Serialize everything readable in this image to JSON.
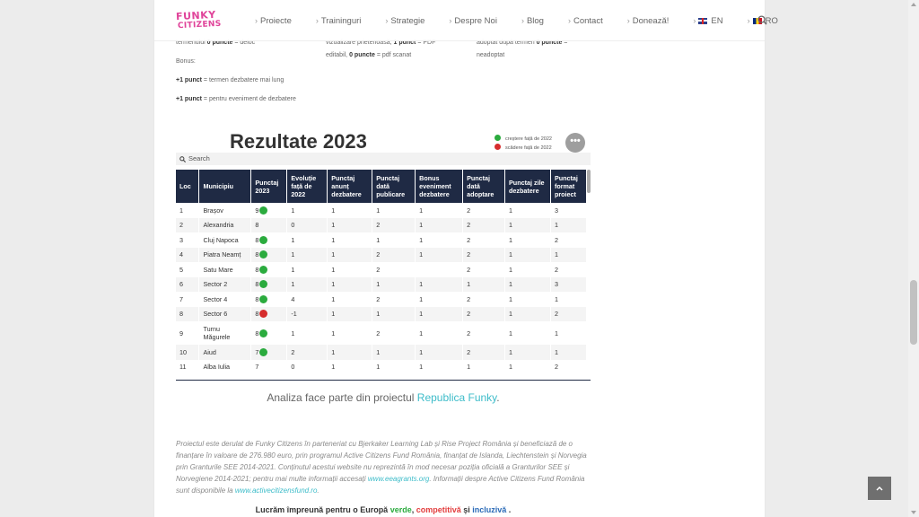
{
  "header": {
    "logo_line1": "FUNKY",
    "logo_line2": "CITIZENS",
    "nav": [
      "Proiecte",
      "Traininguri",
      "Strategie",
      "Despre Noi",
      "Blog",
      "Contact",
      "Donează!"
    ],
    "lang_en": "EN",
    "lang_ro": "RO"
  },
  "prev": {
    "col1_line1_pre": "termenului ",
    "col1_line1_bold": "0 puncte",
    "col1_line1_post": " = deloc",
    "bonus_label": "Bonus:",
    "bonus1_bold": "+1 punct",
    "bonus1_text": " = termen dezbatere mai lung",
    "bonus2_bold": "+1 punct",
    "bonus2_text": " = pentru eveniment de dezbatere",
    "col2_line1_pre": "vizualizare prietenoasă, ",
    "col2_line1_bold": "1 punct",
    "col2_line1_post": " = PDF",
    "col2_line2_pre": "editabil, ",
    "col2_line2_bold": "0 puncte",
    "col2_line2_post": " = pdf scanat",
    "col3_line1_pre": "adoptat după termen ",
    "col3_line1_bold": "0 puncte",
    "col3_line1_post": " =",
    "col3_line2": "neadoptat"
  },
  "widget": {
    "title": "Rezultate 2023",
    "legend_up": "creștere față de 2022",
    "legend_down": "scădere față de 2022",
    "more": "•••",
    "search_placeholder": "Search",
    "colors": {
      "up": "#2bab3e",
      "down": "#d62d2d",
      "header_bg": "#1f2a44"
    },
    "columns": [
      "Loc",
      "Municipiu",
      "Punctaj 2023",
      "Evoluție față de 2022",
      "Punctaj anunț dezbatere",
      "Punctaj dată publicare",
      "Bonus eveniment dezbatere",
      "Punctaj dată adoptare",
      "Punctaj zile dezbatere",
      "Punctaj format proiect"
    ],
    "rows": [
      {
        "loc": "1",
        "mun": "Brașov",
        "score": "9",
        "trend": "up",
        "evo": "1",
        "c4": "1",
        "c5": "1",
        "c6": "1",
        "c7": "2",
        "c8": "1",
        "c9": "3"
      },
      {
        "loc": "2",
        "mun": "Alexandria",
        "score": "8",
        "trend": "",
        "evo": "0",
        "c4": "1",
        "c5": "2",
        "c6": "1",
        "c7": "2",
        "c8": "1",
        "c9": "1"
      },
      {
        "loc": "3",
        "mun": "Cluj Napoca",
        "score": "8",
        "trend": "up",
        "evo": "1",
        "c4": "1",
        "c5": "1",
        "c6": "1",
        "c7": "2",
        "c8": "1",
        "c9": "2"
      },
      {
        "loc": "4",
        "mun": "Piatra Neamț",
        "score": "8",
        "trend": "up",
        "evo": "1",
        "c4": "1",
        "c5": "2",
        "c6": "1",
        "c7": "2",
        "c8": "1",
        "c9": "1"
      },
      {
        "loc": "5",
        "mun": "Satu Mare",
        "score": "8",
        "trend": "up",
        "evo": "1",
        "c4": "1",
        "c5": "2",
        "c6": "",
        "c7": "2",
        "c8": "1",
        "c9": "2"
      },
      {
        "loc": "6",
        "mun": "Sector 2",
        "score": "8",
        "trend": "up",
        "evo": "1",
        "c4": "1",
        "c5": "1",
        "c6": "1",
        "c7": "1",
        "c8": "1",
        "c9": "3"
      },
      {
        "loc": "7",
        "mun": "Sector 4",
        "score": "8",
        "trend": "up",
        "evo": "4",
        "c4": "1",
        "c5": "2",
        "c6": "1",
        "c7": "2",
        "c8": "1",
        "c9": "1"
      },
      {
        "loc": "8",
        "mun": "Sector 6",
        "score": "8",
        "trend": "down",
        "evo": "-1",
        "c4": "1",
        "c5": "1",
        "c6": "1",
        "c7": "2",
        "c8": "1",
        "c9": "2"
      },
      {
        "loc": "9",
        "mun": "Turnu Măgurele",
        "score": "8",
        "trend": "up",
        "evo": "1",
        "c4": "1",
        "c5": "2",
        "c6": "1",
        "c7": "2",
        "c8": "1",
        "c9": "1"
      },
      {
        "loc": "10",
        "mun": "Aiud",
        "score": "7",
        "trend": "up",
        "evo": "2",
        "c4": "1",
        "c5": "1",
        "c6": "1",
        "c7": "2",
        "c8": "1",
        "c9": "1"
      },
      {
        "loc": "11",
        "mun": "Alba Iulia",
        "score": "7",
        "trend": "",
        "evo": "0",
        "c4": "1",
        "c5": "1",
        "c6": "1",
        "c7": "1",
        "c8": "1",
        "c9": "2"
      }
    ]
  },
  "analiza": {
    "text": "Analiza face parte din proiectul ",
    "link": "Republica Funky",
    "end": "."
  },
  "info": {
    "p1": "Proiectul este derulat de Funky Citizens în parteneriat cu Bjerkaker Learning Lab și Rise Project România și beneficiază de o finanțare în valoare de 276.980 euro, prin programul Active Citizens Fund România, finanțat de Islanda, Liechtenstein și Norvegia prin Granturile SEE 2014-2021. Conținutul acestui website nu reprezintă în mod necesar poziția oficială a Granturilor SEE și Norvegiene 2014-2021; pentru mai multe informații accesați ",
    "link1": "www.eeagrants.org",
    "p2": ". Informații despre Active Citizens Fund România sunt disponibile la ",
    "link2": "www.activecitizensfund.ro",
    "p3": "."
  },
  "europe": {
    "pre": "Lucrăm împreună pentru o Europă ",
    "w1": "verde",
    "sep1": ", ",
    "w2": "competitivă",
    "sep2": " și ",
    "w3": "incluzivă",
    "post": " ."
  }
}
